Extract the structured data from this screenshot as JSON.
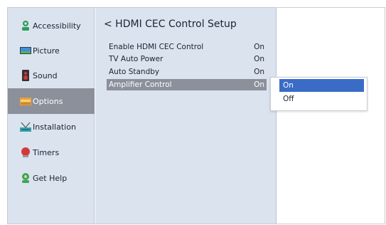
{
  "sidebar": {
    "items": [
      {
        "label": "Accessibility",
        "icon": "accessibility-person-icon",
        "selected": false
      },
      {
        "label": "Picture",
        "icon": "tv-screen-icon",
        "selected": false
      },
      {
        "label": "Sound",
        "icon": "speaker-icon",
        "selected": false
      },
      {
        "label": "Options",
        "icon": "options-folder-icon",
        "selected": true
      },
      {
        "label": "Installation",
        "icon": "antenna-icon",
        "selected": false
      },
      {
        "label": "Timers",
        "icon": "timer-bell-icon",
        "selected": false
      },
      {
        "label": "Get Help",
        "icon": "help-person-icon",
        "selected": false
      }
    ]
  },
  "content": {
    "title": "< HDMI CEC Control Setup",
    "rows": [
      {
        "label": "Enable HDMI CEC Control",
        "value": "On",
        "selected": false
      },
      {
        "label": "TV Auto Power",
        "value": "On",
        "selected": false
      },
      {
        "label": "Auto Standby",
        "value": "On",
        "selected": false
      },
      {
        "label": "Amplifier Control",
        "value": "On",
        "selected": true
      }
    ]
  },
  "dropdown": {
    "options": [
      {
        "label": "On",
        "selected": true
      },
      {
        "label": "Off",
        "selected": false
      }
    ]
  },
  "colors": {
    "panel_bg": "#dbe3ef",
    "selected_bg": "#8b909b",
    "dropdown_selected_bg": "#3a6cc6"
  }
}
